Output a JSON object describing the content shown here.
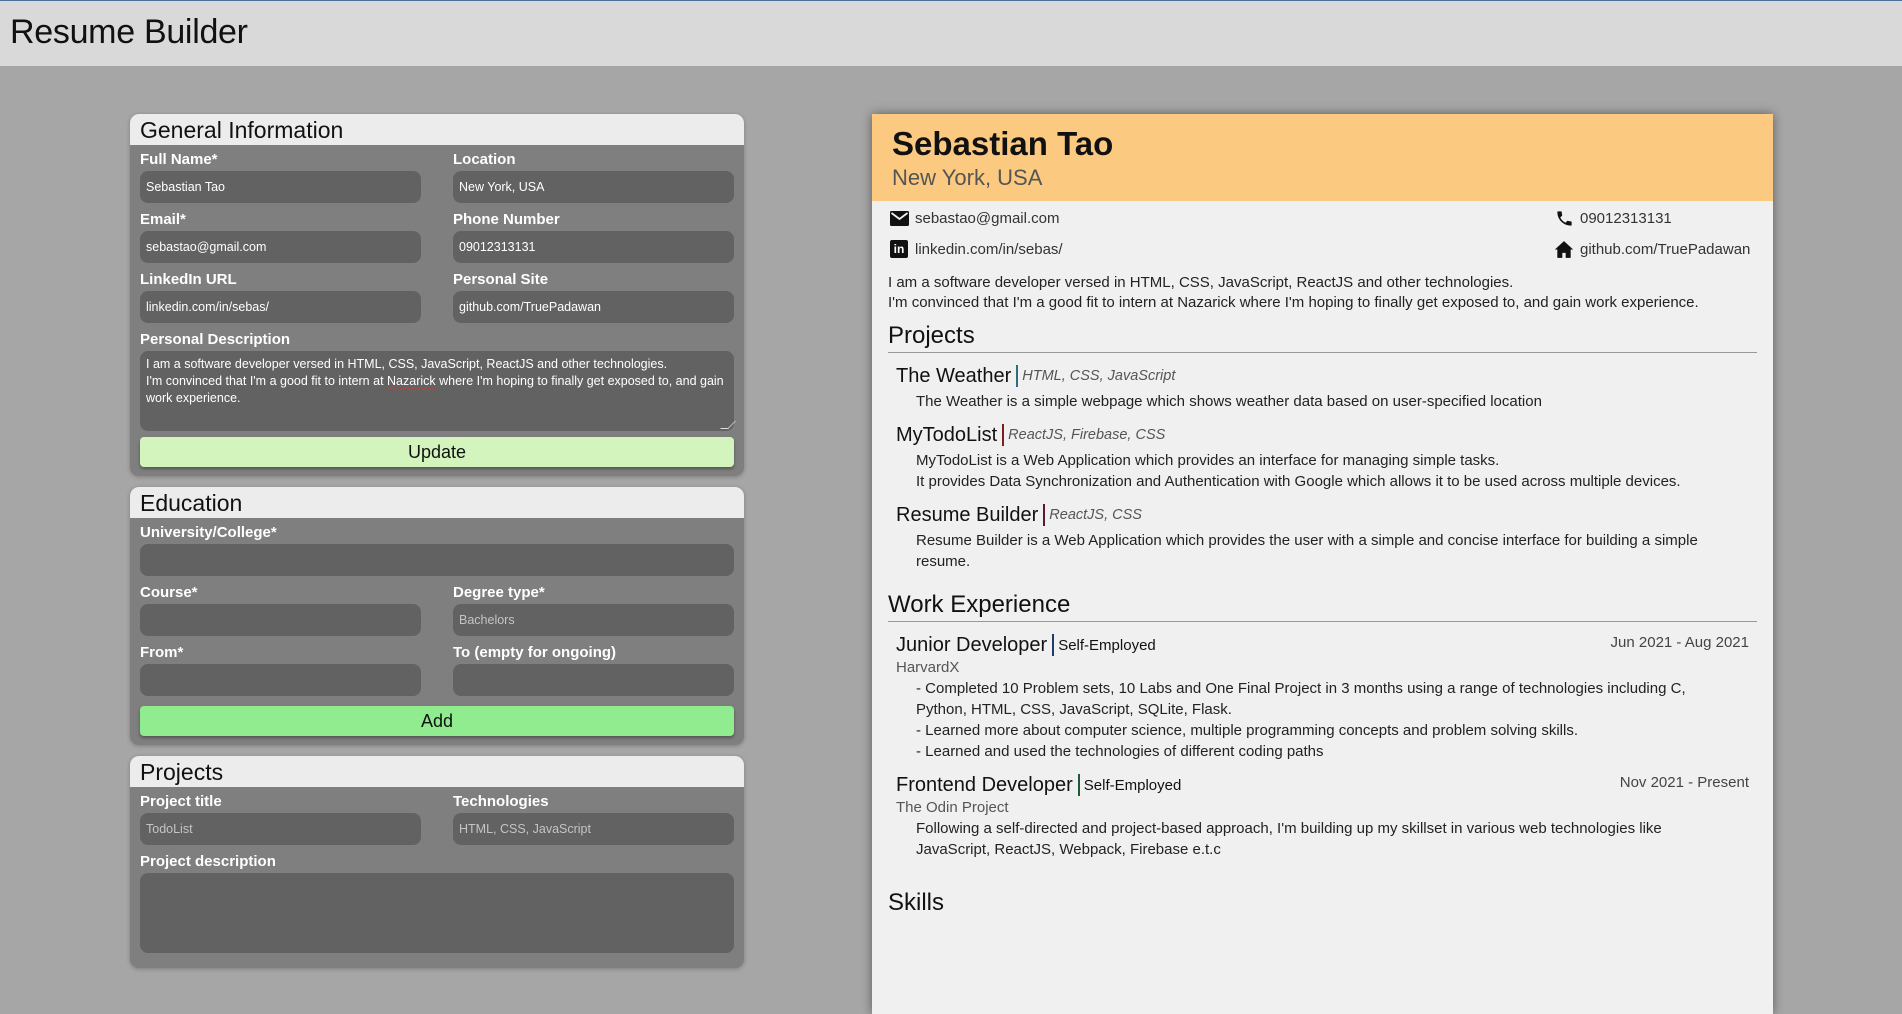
{
  "app": {
    "title": "Resume Builder"
  },
  "forms": {
    "general": {
      "heading": "General Information",
      "full_name": {
        "label": "Full Name*",
        "value": "Sebastian Tao"
      },
      "location": {
        "label": "Location",
        "value": "New York, USA"
      },
      "email": {
        "label": "Email*",
        "value": "sebastao@gmail.com"
      },
      "phone": {
        "label": "Phone Number",
        "value": "09012313131"
      },
      "linkedin": {
        "label": "LinkedIn URL",
        "value": "linkedin.com/in/sebas/"
      },
      "site": {
        "label": "Personal Site",
        "value": "github.com/TruePadawan"
      },
      "description": {
        "label": "Personal Description",
        "line1": "I am a software developer versed in HTML, CSS, JavaScript, ReactJS and other technologies.",
        "line2_pre": "I'm convinced that I'm a good fit to intern at ",
        "line2_misspelled": "Nazarick",
        "line2_post": " where I'm hoping to finally get exposed to, and gain work experience."
      },
      "submit_label": "Update"
    },
    "education": {
      "heading": "Education",
      "university": {
        "label": "University/College*",
        "value": ""
      },
      "course": {
        "label": "Course*",
        "value": ""
      },
      "degree": {
        "label": "Degree type*",
        "placeholder": "Bachelors"
      },
      "from": {
        "label": "From*",
        "value": ""
      },
      "to": {
        "label": "To (empty for ongoing)",
        "value": ""
      },
      "submit_label": "Add"
    },
    "projects": {
      "heading": "Projects",
      "title": {
        "label": "Project title",
        "placeholder": "TodoList"
      },
      "technologies": {
        "label": "Technologies",
        "placeholder": "HTML, CSS, JavaScript"
      },
      "description": {
        "label": "Project description",
        "value": ""
      }
    }
  },
  "resume": {
    "name": "Sebastian Tao",
    "location": "New York, USA",
    "header_color": "#fbca80",
    "contacts": {
      "email": {
        "icon": "mail-icon",
        "text": "sebastao@gmail.com"
      },
      "linkedin": {
        "icon": "linkedin-icon",
        "glyph": "in",
        "text": "linkedin.com/in/sebas/"
      },
      "phone": {
        "icon": "phone-icon",
        "text": "09012313131"
      },
      "site": {
        "icon": "home-icon",
        "text": "github.com/TruePadawan"
      }
    },
    "summary": [
      "I am a software developer versed in HTML, CSS, JavaScript, ReactJS and other technologies.",
      "I'm convinced that I'm a good fit to intern at Nazarick where I'm hoping to finally get exposed to, and gain work experience."
    ],
    "projects_heading": "Projects",
    "projects": [
      {
        "name": "The Weather",
        "tech": "HTML, CSS, JavaScript",
        "bar_color": "#2a6f7a",
        "desc": [
          "The Weather is a simple webpage which shows weather data based on user-specified location"
        ]
      },
      {
        "name": "MyTodoList",
        "tech": "ReactJS, Firebase, CSS",
        "bar_color": "#7a1e1e",
        "desc": [
          "MyTodoList is a Web Application which provides an interface for managing simple tasks.",
          "It provides Data Synchronization and Authentication with Google which allows it to be used across multiple devices."
        ]
      },
      {
        "name": "Resume Builder",
        "tech": "ReactJS, CSS",
        "bar_color": "#5a1a2a",
        "desc": [
          "Resume Builder is a Web Application which provides the user with a simple and concise interface for building a simple resume."
        ]
      }
    ],
    "work_heading": "Work Experience",
    "jobs": [
      {
        "role": "Junior Developer",
        "type": "Self-Employed",
        "bar_color": "#1e3a6a",
        "dates": "Jun 2021 - Aug 2021",
        "org": "HarvardX",
        "desc": [
          "- Completed 10 Problem sets, 10 Labs and One Final Project in 3 months using a range of technologies including C, Python, HTML, CSS, JavaScript, SQLite, Flask.",
          "- Learned more about computer science, multiple programming concepts and problem solving skills.",
          "- Learned and used the technologies of different coding paths"
        ]
      },
      {
        "role": "Frontend Developer",
        "type": "Self-Employed",
        "bar_color": "#1e5a3a",
        "dates": "Nov 2021 - Present",
        "org": "The Odin Project",
        "desc": [
          "Following a self-directed and project-based approach, I'm building up my skillset in various web technologies like JavaScript, ReactJS, Webpack, Firebase e.t.c"
        ]
      }
    ],
    "skills_heading": "Skills"
  }
}
